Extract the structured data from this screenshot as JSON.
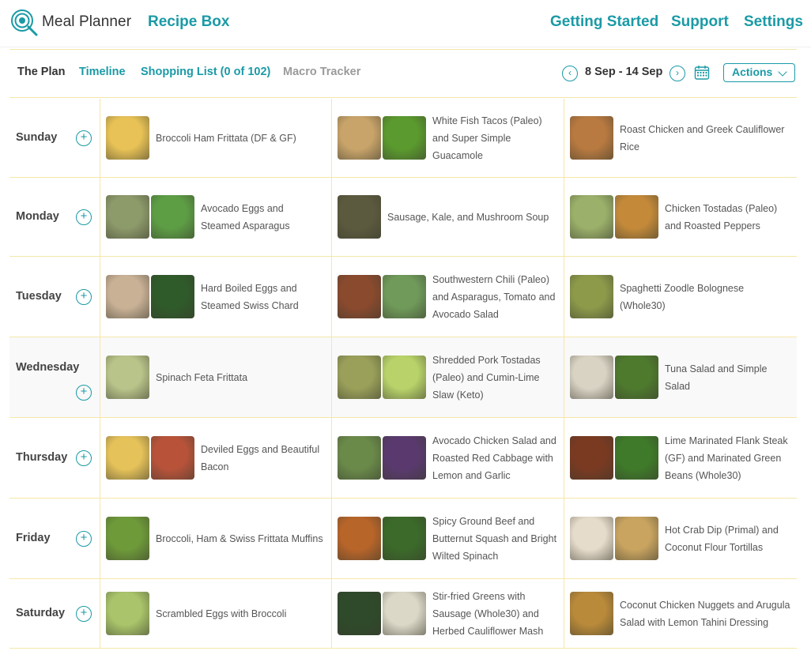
{
  "app": {
    "name": "Meal Planner",
    "recipe_box": "Recipe Box"
  },
  "nav": {
    "getting_started": "Getting Started",
    "support": "Support",
    "settings": "Settings"
  },
  "tabs": {
    "plan": "The Plan",
    "timeline": "Timeline",
    "shopping": "Shopping List (0 of 102)",
    "macro": "Macro Tracker"
  },
  "date_range": "8 Sep - 14 Sep",
  "actions_label": "Actions",
  "colors": {
    "accent": "#1b9aa6",
    "grid_line": "#f5e7a8"
  },
  "days": [
    {
      "name": "Sunday",
      "meals": [
        {
          "title": "Broccoli Ham Frittata (DF & GF)",
          "thumbs": [
            "#e8c256"
          ]
        },
        {
          "title": "White Fish Tacos (Paleo) and Super Simple Guacamole",
          "thumbs": [
            "#c9a46a",
            "#5b9a2e"
          ]
        },
        {
          "title": "Roast Chicken and Greek Cauliflower Rice",
          "thumbs": [
            "#b87a40"
          ]
        }
      ]
    },
    {
      "name": "Monday",
      "meals": [
        {
          "title": "Avocado Eggs and Steamed Asparagus",
          "thumbs": [
            "#8d9a6a",
            "#5d9e45"
          ]
        },
        {
          "title": "Sausage, Kale, and Mushroom Soup",
          "thumbs": [
            "#5c5a3e"
          ]
        },
        {
          "title": "Chicken Tostadas (Paleo) and Roasted Peppers",
          "thumbs": [
            "#9bb06a",
            "#c48a3a"
          ]
        }
      ]
    },
    {
      "name": "Tuesday",
      "meals": [
        {
          "title": "Hard Boiled Eggs and Steamed Swiss Chard",
          "thumbs": [
            "#c9b196",
            "#2f5a2a"
          ]
        },
        {
          "title": "Southwestern Chili (Paleo) and Asparagus, Tomato and Avocado Salad",
          "thumbs": [
            "#8a4a2e",
            "#6f9a5a"
          ]
        },
        {
          "title": "Spaghetti Zoodle Bolognese (Whole30)",
          "thumbs": [
            "#8c9a4a"
          ]
        }
      ]
    },
    {
      "name": "Wednesday",
      "meals": [
        {
          "title": "Spinach Feta Frittata",
          "thumbs": [
            "#b9c48a"
          ]
        },
        {
          "title": "Shredded Pork Tostadas (Paleo) and Cumin-Lime Slaw (Keto)",
          "thumbs": [
            "#9aa05a",
            "#b9d36a"
          ]
        },
        {
          "title": "Tuna Salad and Simple Salad",
          "thumbs": [
            "#d9d3c4",
            "#4e7a2e"
          ]
        }
      ]
    },
    {
      "name": "Thursday",
      "meals": [
        {
          "title": "Deviled Eggs and Beautiful Bacon",
          "thumbs": [
            "#e6c25a",
            "#b8533a"
          ]
        },
        {
          "title": "Avocado Chicken Salad and Roasted Red Cabbage with Lemon and Garlic",
          "thumbs": [
            "#6a8a4a",
            "#5a3a6e"
          ]
        },
        {
          "title": "Lime Marinated Flank Steak (GF) and Marinated Green Beans (Whole30)",
          "thumbs": [
            "#7a3a22",
            "#3f7a2a"
          ]
        }
      ]
    },
    {
      "name": "Friday",
      "meals": [
        {
          "title": "Broccoli, Ham & Swiss Frittata Muffins",
          "thumbs": [
            "#6e9a3a"
          ]
        },
        {
          "title": "Spicy Ground Beef and Butternut Squash and Bright Wilted Spinach",
          "thumbs": [
            "#b8652a",
            "#3b6a2a"
          ]
        },
        {
          "title": "Hot Crab Dip (Primal) and Coconut Flour Tortillas",
          "thumbs": [
            "#e6dccb",
            "#c9a460"
          ]
        }
      ]
    },
    {
      "name": "Saturday",
      "meals": [
        {
          "title": "Scrambled Eggs with Broccoli",
          "thumbs": [
            "#a9c46a"
          ]
        },
        {
          "title": "Stir-fried Greens with Sausage (Whole30) and Herbed Cauliflower Mash",
          "thumbs": [
            "#2e4a2a",
            "#dcd8c8"
          ]
        },
        {
          "title": "Coconut Chicken Nuggets and Arugula Salad with Lemon Tahini Dressing",
          "thumbs": [
            "#b98a3a"
          ]
        }
      ]
    }
  ]
}
